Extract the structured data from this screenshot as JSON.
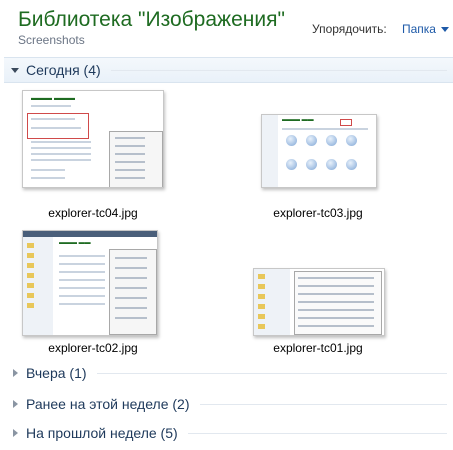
{
  "header": {
    "title": "Библиотека \"Изображения\"",
    "subtitle": "Screenshots",
    "arrange_label": "Упорядочить:",
    "arrange_value": "Папка"
  },
  "groups": [
    {
      "label": "Сегодня (4)",
      "expanded": true
    },
    {
      "label": "Вчера (1)",
      "expanded": false
    },
    {
      "label": "Ранее на этой неделе (2)",
      "expanded": false
    },
    {
      "label": "На прошлой неделе (5)",
      "expanded": false
    }
  ],
  "files": [
    {
      "name": "explorer-tc04.jpg"
    },
    {
      "name": "explorer-tc03.jpg"
    },
    {
      "name": "explorer-tc02.jpg"
    },
    {
      "name": "explorer-tc01.jpg"
    }
  ],
  "colors": {
    "title_green": "#1e6b21",
    "link_blue": "#1e5aa8",
    "group_text": "#1e395b"
  },
  "icons": {
    "expand": "chevron-down-icon",
    "collapse": "chevron-right-icon",
    "dropdown": "caret-down-icon"
  }
}
